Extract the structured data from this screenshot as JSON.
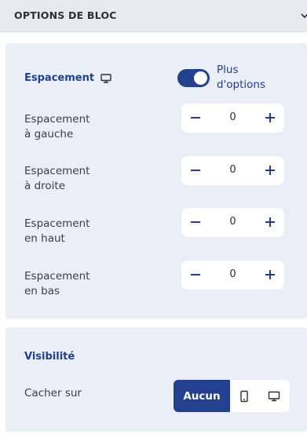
{
  "header": {
    "title": "OPTIONS DE BLOC",
    "chevron_icon": "chevron-down-icon"
  },
  "spacing": {
    "title": "Espacement",
    "device_icon": "monitor-icon",
    "more_options_label_line1": "Plus",
    "more_options_label_line2": "d'options",
    "more_options_enabled": true,
    "rows": [
      {
        "label_line1": "Espacement",
        "label_line2": "à gauche",
        "value": "0"
      },
      {
        "label_line1": "Espacement",
        "label_line2": "à droite",
        "value": "0"
      },
      {
        "label_line1": "Espacement",
        "label_line2": "en haut",
        "value": "0"
      },
      {
        "label_line1": "Espacement",
        "label_line2": "en bas",
        "value": "0"
      }
    ]
  },
  "visibility": {
    "title": "Visibilité",
    "hide_on_label": "Cacher sur",
    "options": [
      {
        "label": "Aucun",
        "selected": true
      },
      {
        "icon": "mobile-icon",
        "selected": false
      },
      {
        "icon": "desktop-icon",
        "selected": false
      }
    ]
  },
  "colors": {
    "accent": "#23408e",
    "card": "#e9eef7",
    "header": "#e6e9ef"
  }
}
